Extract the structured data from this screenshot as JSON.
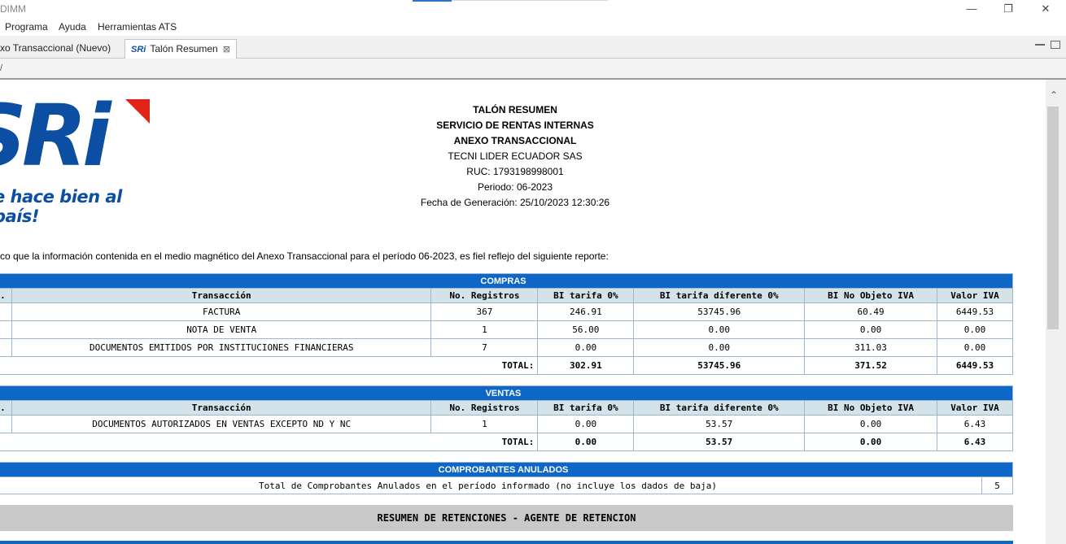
{
  "window": {
    "title": "DIMM",
    "minimize_glyph": "—",
    "restore_glyph": "❐",
    "close_glyph": "✕"
  },
  "menu": [
    "Programa",
    "Ayuda",
    "Herramientas ATS"
  ],
  "tabs": {
    "inactive_label": "xo Transaccional (Nuevo)",
    "active_icon_text": "SRi",
    "active_label": "Talón Resumen",
    "close_glyph": "⊠"
  },
  "toolbar": {
    "glyph": "/"
  },
  "logo": {
    "brand": "SRi",
    "slogan": "e hace bien al país!"
  },
  "header": {
    "line1": "TALÓN RESUMEN",
    "line2": "SERVICIO DE RENTAS INTERNAS",
    "line3": "ANEXO TRANSACCIONAL",
    "company": "TECNI LIDER ECUADOR SAS",
    "ruc": "RUC: 1793198998001",
    "periodo": "Periodo: 06-2023",
    "fecha": "Fecha de Generación: 25/10/2023 12:30:26"
  },
  "statement": "co que la información contenida en el medio magnético del Anexo Transaccional para el período 06-2023, es fiel reflejo del siguiente reporte:",
  "columns": {
    "first": ".",
    "transaccion": "Transacción",
    "registros": "No. Registros",
    "bi0": "BI tarifa 0%",
    "bidif": "BI tarifa diferente 0%",
    "bino": "BI No Objeto IVA",
    "iva": "Valor IVA"
  },
  "compras": {
    "title": "COMPRAS",
    "rows": [
      {
        "transaccion": "FACTURA",
        "registros": "367",
        "bi0": "246.91",
        "bidif": "53745.96",
        "bino": "60.49",
        "iva": "6449.53"
      },
      {
        "transaccion": "NOTA DE VENTA",
        "registros": "1",
        "bi0": "56.00",
        "bidif": "0.00",
        "bino": "0.00",
        "iva": "0.00"
      },
      {
        "transaccion": "DOCUMENTOS EMITIDOS POR INSTITUCIONES FINANCIERAS",
        "registros": "7",
        "bi0": "0.00",
        "bidif": "0.00",
        "bino": "311.03",
        "iva": "0.00"
      }
    ],
    "total": {
      "label": "TOTAL:",
      "bi0": "302.91",
      "bidif": "53745.96",
      "bino": "371.52",
      "iva": "6449.53"
    }
  },
  "ventas": {
    "title": "VENTAS",
    "rows": [
      {
        "transaccion": "DOCUMENTOS AUTORIZADOS EN VENTAS EXCEPTO ND Y NC",
        "registros": "1",
        "bi0": "0.00",
        "bidif": "53.57",
        "bino": "0.00",
        "iva": "6.43"
      }
    ],
    "total": {
      "label": "TOTAL:",
      "bi0": "0.00",
      "bidif": "53.57",
      "bino": "0.00",
      "iva": "6.43"
    }
  },
  "anulados": {
    "title": "COMPROBANTES ANULADOS",
    "description": "Total de Comprobantes Anulados en el período informado (no incluye los dados de baja)",
    "count": "5"
  },
  "retenciones": {
    "title": "RESUMEN DE RETENCIONES - AGENTE DE RETENCION"
  },
  "colors": {
    "section_blue": "#0e66c6",
    "header_row": "#d4e2ea",
    "brand_blue": "#0b4ea2",
    "brand_red": "#e2231a"
  }
}
